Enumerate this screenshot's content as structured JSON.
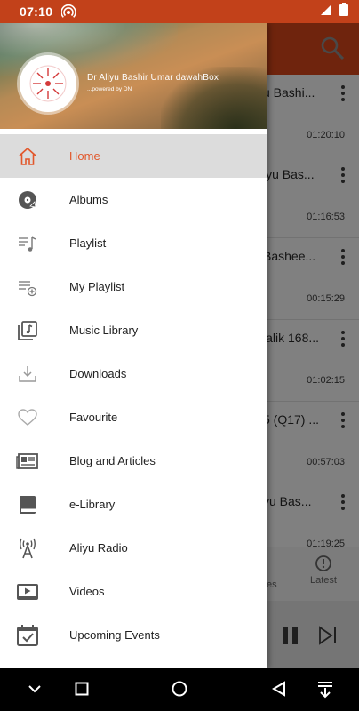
{
  "status": {
    "time": "07:10"
  },
  "drawer": {
    "title": "Dr Aliyu Bashir Umar dawahBox",
    "subtitle": "...powered by DN",
    "items": [
      {
        "label": "Home",
        "icon": "home-icon",
        "active": true
      },
      {
        "label": "Albums",
        "icon": "album-disc-icon"
      },
      {
        "label": "Playlist",
        "icon": "playlist-icon"
      },
      {
        "label": "My Playlist",
        "icon": "playlist-add-icon"
      },
      {
        "label": "Music Library",
        "icon": "music-library-icon"
      },
      {
        "label": "Downloads",
        "icon": "download-icon"
      },
      {
        "label": "Favourite",
        "icon": "heart-icon"
      },
      {
        "label": "Blog and Articles",
        "icon": "newspaper-icon"
      },
      {
        "label": "e-Library",
        "icon": "book-icon"
      },
      {
        "label": "Aliyu Radio",
        "icon": "radio-tower-icon"
      },
      {
        "label": "Videos",
        "icon": "video-icon"
      },
      {
        "label": "Upcoming Events",
        "icon": "calendar-check-icon"
      }
    ]
  },
  "songs": [
    {
      "title": "u Bashi...",
      "duration": "01:20:10"
    },
    {
      "title": "iyu Bas...",
      "duration": "01:16:53"
    },
    {
      "title": "Bashee...",
      "duration": "00:15:29"
    },
    {
      "title": "lalik 168...",
      "duration": "01:02:15"
    },
    {
      "title": "5 (Q17) ...",
      "duration": "00:57:03"
    },
    {
      "title": "yu Bas...",
      "duration": "01:19:25"
    }
  ],
  "tabs": {
    "partial": "es",
    "latest": "Latest"
  },
  "colors": {
    "accent": "#e2572b",
    "appbar": "#c2411a",
    "active_bg": "#dcdcdc",
    "icon": "#555555"
  }
}
